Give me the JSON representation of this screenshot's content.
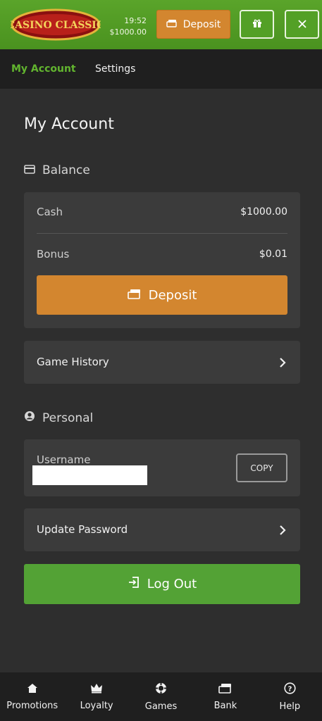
{
  "header": {
    "logo_text": "CASINO CLASSIC",
    "time": "19:52",
    "balance": "$1000.00",
    "deposit_label": "Deposit",
    "icons": [
      "gift-icon",
      "close-icon"
    ]
  },
  "tabs": [
    {
      "label": "My Account",
      "active": true
    },
    {
      "label": "Settings",
      "active": false
    }
  ],
  "page_title": "My Account",
  "balance_section": {
    "heading": "Balance",
    "rows": [
      {
        "label": "Cash",
        "value": "$1000.00"
      },
      {
        "label": "Bonus",
        "value": "$0.01"
      }
    ],
    "deposit_label": "Deposit"
  },
  "game_history_label": "Game History",
  "personal_section": {
    "heading": "Personal",
    "username_label": "Username",
    "copy_label": "COPY"
  },
  "update_password_label": "Update Password",
  "logout_label": "Log Out",
  "bottom_nav": [
    {
      "label": "Promotions",
      "icon": "home-icon"
    },
    {
      "label": "Loyalty",
      "icon": "crown-icon"
    },
    {
      "label": "Games",
      "icon": "chip-icon"
    },
    {
      "label": "Bank",
      "icon": "money-icon"
    },
    {
      "label": "Help",
      "icon": "help-icon"
    }
  ],
  "colors": {
    "header_green": "#53a026",
    "accent_orange": "#d3862f",
    "active_tab": "#62b52f",
    "logout_green": "#53a235"
  }
}
